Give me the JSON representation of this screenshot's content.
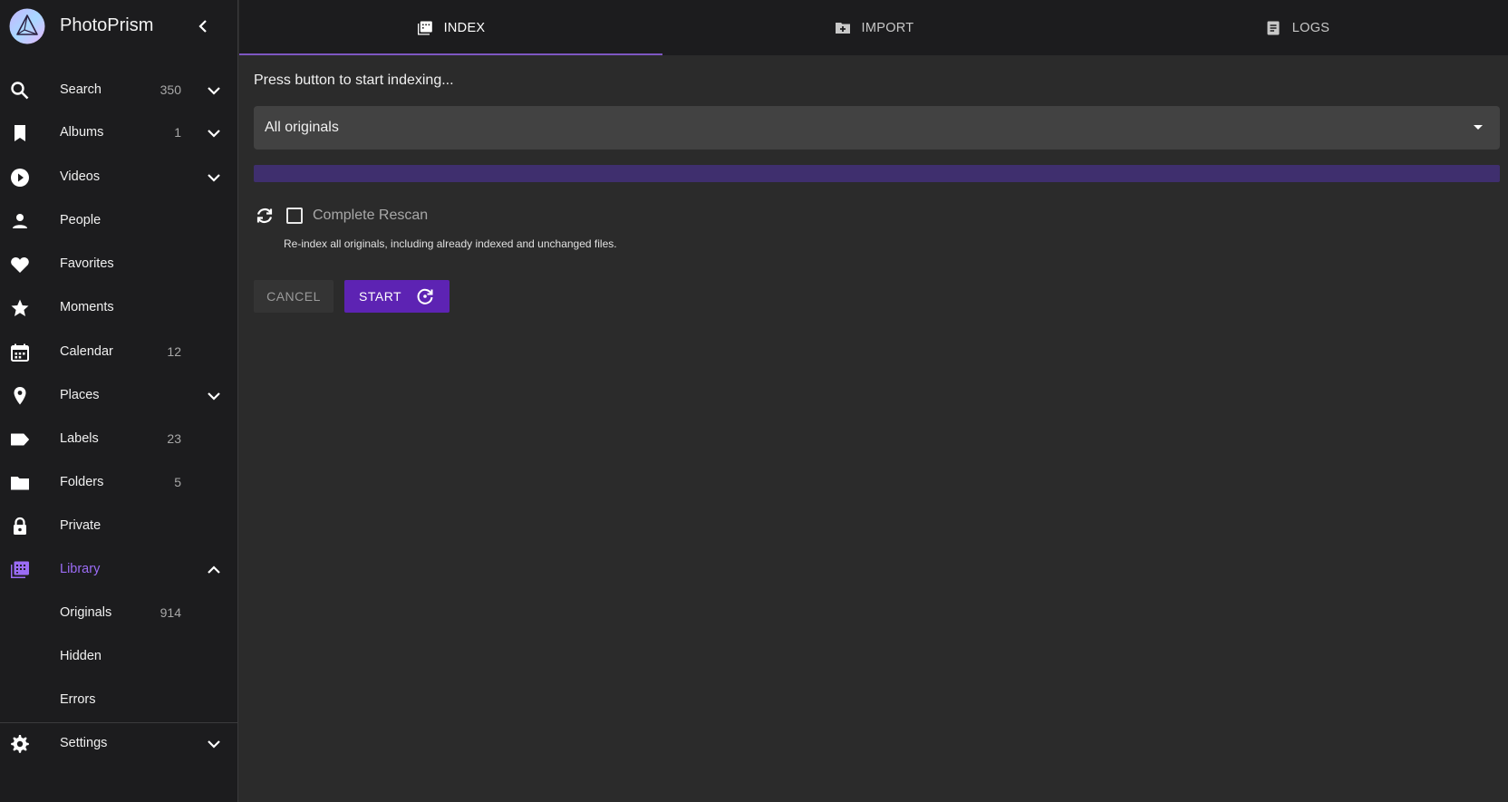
{
  "app": {
    "name": "PhotoPrism"
  },
  "sidebar": {
    "items": [
      {
        "label": "Search",
        "count": "350",
        "icon": "search-icon",
        "expand": "chevron-down-icon"
      },
      {
        "label": "Albums",
        "count": "1",
        "icon": "bookmark-icon",
        "expand": "chevron-down-icon"
      },
      {
        "label": "Videos",
        "count": "",
        "icon": "play-circle-icon",
        "expand": "chevron-down-icon"
      },
      {
        "label": "People",
        "count": "",
        "icon": "person-icon"
      },
      {
        "label": "Favorites",
        "count": "",
        "icon": "heart-icon"
      },
      {
        "label": "Moments",
        "count": "",
        "icon": "star-icon"
      },
      {
        "label": "Calendar",
        "count": "12",
        "icon": "calendar-icon"
      },
      {
        "label": "Places",
        "count": "",
        "icon": "location-pin-icon",
        "expand": "chevron-down-icon"
      },
      {
        "label": "Labels",
        "count": "23",
        "icon": "label-tag-icon"
      },
      {
        "label": "Folders",
        "count": "5",
        "icon": "folder-icon"
      },
      {
        "label": "Private",
        "count": "",
        "icon": "lock-icon"
      },
      {
        "label": "Library",
        "count": "",
        "icon": "library-icon",
        "expand": "chevron-up-icon",
        "active": true
      },
      {
        "label": "Originals",
        "count": "914"
      },
      {
        "label": "Hidden",
        "count": ""
      },
      {
        "label": "Errors",
        "count": ""
      },
      {
        "label": "Settings",
        "count": "",
        "icon": "gear-icon",
        "expand": "chevron-down-icon"
      }
    ]
  },
  "tabs": [
    {
      "label": "INDEX",
      "icon": "folder-index-icon",
      "active": true
    },
    {
      "label": "IMPORT",
      "icon": "folder-plus-icon"
    },
    {
      "label": "LOGS",
      "icon": "file-document-icon"
    }
  ],
  "index": {
    "hint": "Press button to start indexing...",
    "select_value": "All originals",
    "progress": 0,
    "rescan_label": "Complete Rescan",
    "rescan_description": "Re-index all originals, including already indexed and unchanged files.",
    "rescan_checked": false,
    "cancel_label": "CANCEL",
    "start_label": "START"
  },
  "colors": {
    "accent": "#7e57c2",
    "active_text": "#9b6cf5",
    "button_primary": "#5d23b3",
    "sidebar_bg": "#1c1c1e",
    "content_bg": "#2b2b2b"
  }
}
